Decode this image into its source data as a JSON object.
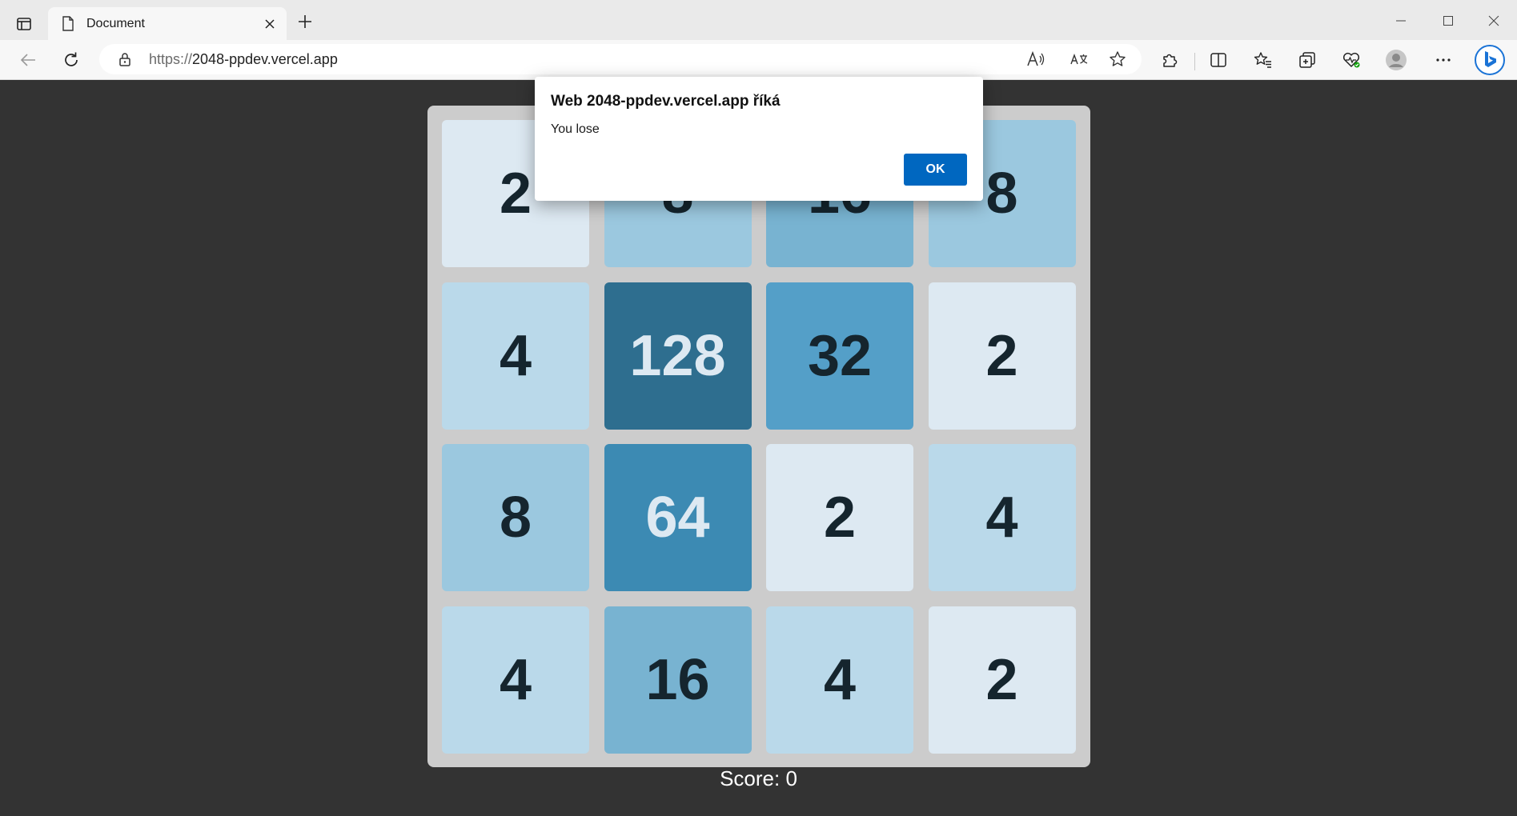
{
  "browser": {
    "tab": {
      "title": "Document"
    },
    "address": {
      "protocol": "https://",
      "host": "2048-ppdev.vercel.app"
    }
  },
  "game": {
    "tiles": [
      {
        "value": "2",
        "color": "#dde9f2",
        "text_color": "#15252e"
      },
      {
        "value": "8",
        "color": "#9bc8df",
        "text_color": "#15252e"
      },
      {
        "value": "16",
        "color": "#78b3d1",
        "text_color": "#15252e"
      },
      {
        "value": "8",
        "color": "#9bc8df",
        "text_color": "#15252e"
      },
      {
        "value": "4",
        "color": "#bad9ea",
        "text_color": "#15252e"
      },
      {
        "value": "128",
        "color": "#2e6e8f",
        "text_color": "#dde9f2"
      },
      {
        "value": "32",
        "color": "#549fc8",
        "text_color": "#15252e"
      },
      {
        "value": "2",
        "color": "#dde9f2",
        "text_color": "#15252e"
      },
      {
        "value": "8",
        "color": "#9bc8df",
        "text_color": "#15252e"
      },
      {
        "value": "64",
        "color": "#3c8ab3",
        "text_color": "#dde9f2"
      },
      {
        "value": "2",
        "color": "#dde9f2",
        "text_color": "#15252e"
      },
      {
        "value": "4",
        "color": "#bad9ea",
        "text_color": "#15252e"
      },
      {
        "value": "4",
        "color": "#bad9ea",
        "text_color": "#15252e"
      },
      {
        "value": "16",
        "color": "#78b3d1",
        "text_color": "#15252e"
      },
      {
        "value": "4",
        "color": "#bad9ea",
        "text_color": "#15252e"
      },
      {
        "value": "2",
        "color": "#dde9f2",
        "text_color": "#15252e"
      }
    ],
    "score_text": "Score: 0"
  },
  "dialog": {
    "title": "Web 2048-ppdev.vercel.app říká",
    "message": "You lose",
    "ok_label": "OK"
  },
  "colors": {
    "page_background": "#333333",
    "board_background": "#cccccc",
    "ok_button": "#0067c0"
  }
}
